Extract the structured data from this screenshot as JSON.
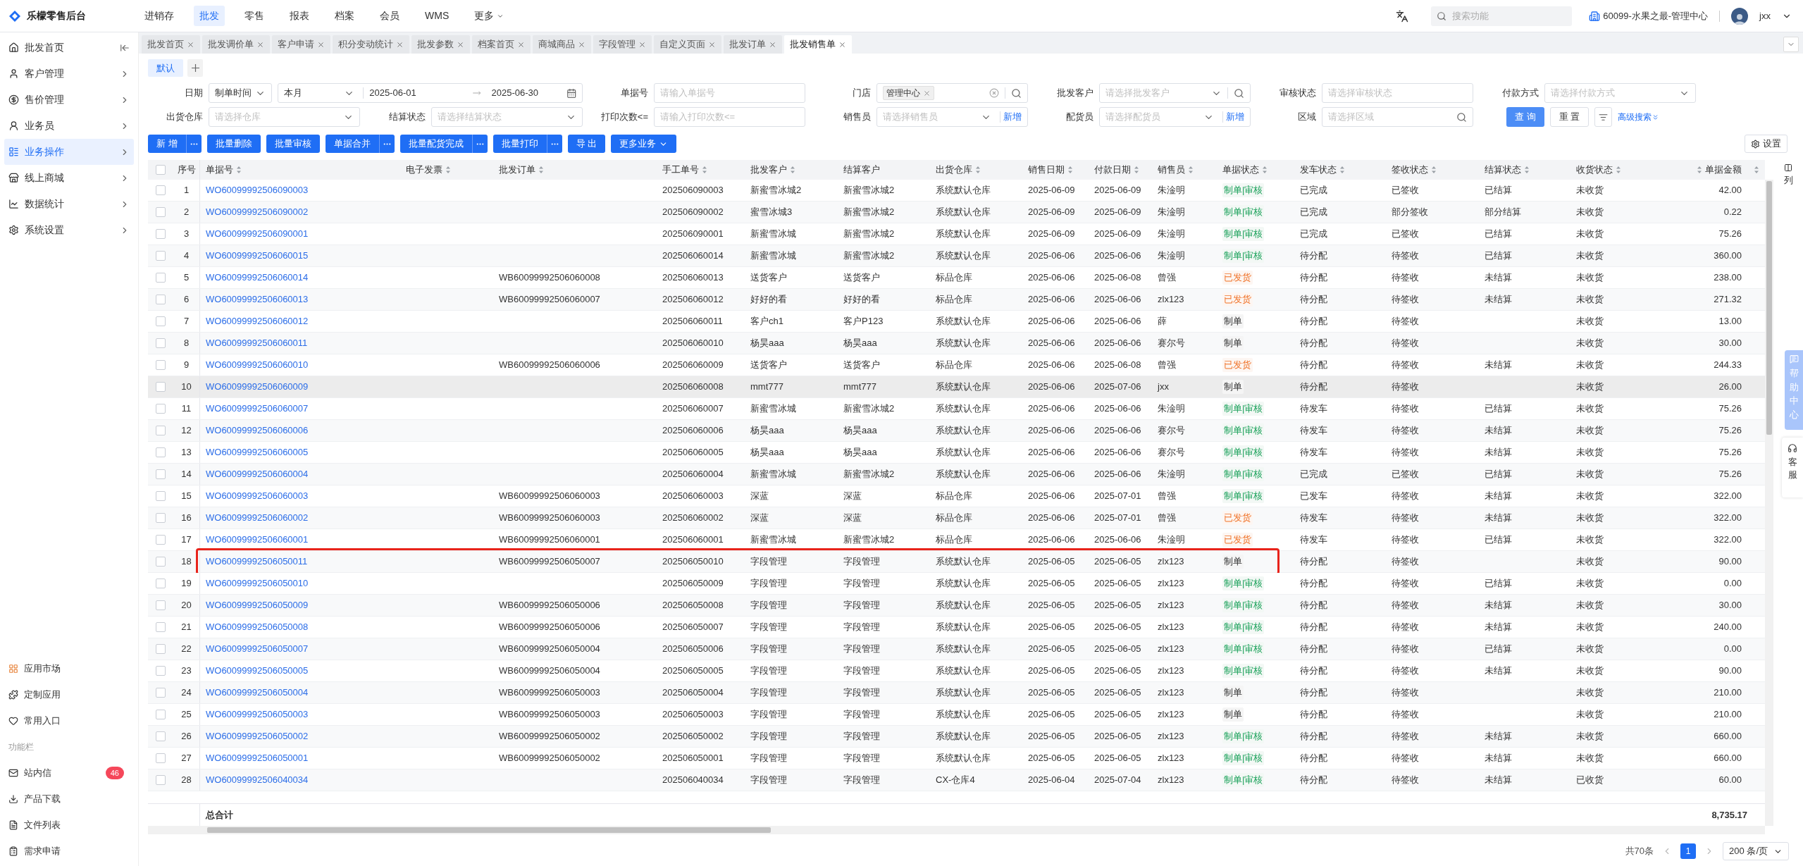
{
  "topbar": {
    "brand": "乐檬零售后台",
    "nav": [
      {
        "label": "进销存",
        "selected": false,
        "dropdown": false
      },
      {
        "label": "批发",
        "selected": true,
        "dropdown": false
      },
      {
        "label": "零售",
        "selected": false,
        "dropdown": false
      },
      {
        "label": "报表",
        "selected": false,
        "dropdown": false
      },
      {
        "label": "档案",
        "selected": false,
        "dropdown": false
      },
      {
        "label": "会员",
        "selected": false,
        "dropdown": false
      },
      {
        "label": "WMS",
        "selected": false,
        "dropdown": false
      },
      {
        "label": "更多",
        "selected": false,
        "dropdown": true
      }
    ],
    "search": {
      "placeholder": "搜索功能"
    },
    "org": "60099-水果之最-管理中心",
    "user": "jxx"
  },
  "sidebar": {
    "items": [
      {
        "label": "批发首页",
        "selected": false,
        "expandable": false
      },
      {
        "label": "客户管理",
        "selected": false,
        "expandable": true
      },
      {
        "label": "售价管理",
        "selected": false,
        "expandable": true
      },
      {
        "label": "业务员",
        "selected": false,
        "expandable": true
      },
      {
        "label": "业务操作",
        "selected": true,
        "expandable": true
      },
      {
        "label": "线上商城",
        "selected": false,
        "expandable": true
      },
      {
        "label": "数据统计",
        "selected": false,
        "expandable": true
      },
      {
        "label": "系统设置",
        "selected": false,
        "expandable": true
      }
    ],
    "bottom_items": [
      {
        "label": "应用市场"
      },
      {
        "label": "定制应用"
      },
      {
        "label": "常用入口"
      }
    ],
    "section_label": "功能栏",
    "tool_items": [
      {
        "label": "站内信",
        "badge": "46"
      },
      {
        "label": "产品下载"
      },
      {
        "label": "文件列表"
      },
      {
        "label": "需求申请"
      }
    ]
  },
  "tabs": [
    {
      "label": "批发首页",
      "selected": false
    },
    {
      "label": "批发调价单",
      "selected": false
    },
    {
      "label": "客户申请",
      "selected": false
    },
    {
      "label": "积分变动统计",
      "selected": false
    },
    {
      "label": "批发参数",
      "selected": false
    },
    {
      "label": "档案首页",
      "selected": false
    },
    {
      "label": "商城商品",
      "selected": false
    },
    {
      "label": "字段管理",
      "selected": false
    },
    {
      "label": "自定义页面",
      "selected": false
    },
    {
      "label": "批发订单",
      "selected": false
    },
    {
      "label": "批发销售单",
      "selected": true
    }
  ],
  "filters": {
    "presets": [
      {
        "label": "默认",
        "selected": true
      }
    ],
    "fields": [
      {
        "label": "日期",
        "kind": "date_range",
        "mode": "制单时间",
        "period": "本月",
        "start": "2025-06-01",
        "end": "2025-06-30"
      },
      {
        "label": "单据号",
        "kind": "text",
        "placeholder": "请输入单据号"
      },
      {
        "label": "门店",
        "kind": "tag_search",
        "tags": [
          "管理中心"
        ]
      },
      {
        "label": "批发客户",
        "kind": "select_search",
        "placeholder": "请选择批发客户"
      },
      {
        "label": "审核状态",
        "kind": "text",
        "placeholder": "请选择审核状态"
      },
      {
        "label": "付款方式",
        "kind": "select",
        "placeholder": "请选择付款方式"
      },
      {
        "label": "出货仓库",
        "kind": "select",
        "placeholder": "请选择仓库"
      },
      {
        "label": "结算状态",
        "kind": "select",
        "placeholder": "请选择结算状态"
      },
      {
        "label": "打印次数<=",
        "kind": "text",
        "placeholder": "请输入打印次数<="
      },
      {
        "label": "销售员",
        "kind": "select_add",
        "placeholder": "请选择销售员",
        "add_label": "新增"
      },
      {
        "label": "配货员",
        "kind": "select_add",
        "placeholder": "请选择配货员",
        "add_label": "新增"
      },
      {
        "label": "区域",
        "kind": "search",
        "placeholder": "请选择区域"
      }
    ],
    "buttons": [
      {
        "label": "查 询",
        "kind": "primary"
      },
      {
        "label": "重 置",
        "kind": "default"
      }
    ],
    "advanced_search": "高级搜索"
  },
  "actions": [
    {
      "label": "新 增",
      "more": true,
      "dropdown": false
    },
    {
      "label": "批量删除",
      "more": false,
      "dropdown": false
    },
    {
      "label": "批量审核",
      "more": false,
      "dropdown": false
    },
    {
      "label": "单据合并",
      "more": true,
      "dropdown": false
    },
    {
      "label": "批量配货完成",
      "more": true,
      "dropdown": false
    },
    {
      "label": "批量打印",
      "more": true,
      "dropdown": false
    },
    {
      "label": "导 出",
      "more": false,
      "dropdown": false
    },
    {
      "label": "更多业务",
      "more": false,
      "dropdown": true
    }
  ],
  "settings_button": "设置",
  "column_settings": "列",
  "help_center": "帮助中心",
  "customer_service": "客服",
  "table": {
    "select_all_checked": false,
    "columns": [
      {
        "label": "序号",
        "sortable": false
      },
      {
        "label": "单据号",
        "sortable": true
      },
      {
        "label": "电子发票",
        "sortable": true
      },
      {
        "label": "批发订单",
        "sortable": true
      },
      {
        "label": "手工单号",
        "sortable": true
      },
      {
        "label": "批发客户",
        "sortable": true
      },
      {
        "label": "结算客户",
        "sortable": false
      },
      {
        "label": "出货仓库",
        "sortable": true
      },
      {
        "label": "销售日期",
        "sortable": true
      },
      {
        "label": "付款日期",
        "sortable": true
      },
      {
        "label": "销售员",
        "sortable": true
      },
      {
        "label": "单据状态",
        "sortable": true
      },
      {
        "label": "发车状态",
        "sortable": true
      },
      {
        "label": "签收状态",
        "sortable": true
      },
      {
        "label": "结算状态",
        "sortable": true
      },
      {
        "label": "收货状态",
        "sortable": true
      },
      {
        "label": "单据金额",
        "sortable": true
      }
    ],
    "rows": [
      {
        "seq": "1",
        "doc_no": "WO60099992506090003",
        "manual_no": "202506090003",
        "wholesale_customer": "新蜜雪冰城2",
        "settle_customer": "新蜜雪冰城2",
        "warehouse": "系统默认仓库",
        "sale_date": "2025-06-09",
        "pay_date": "2025-06-09",
        "salesperson": "朱淦明",
        "doc_status": {
          "text": "制单|审核",
          "kind": "approved"
        },
        "dispatch_status": "已完成",
        "sign_status": "已签收",
        "settle_status": "已结算",
        "receive_status": "未收货",
        "amount": "42.00",
        "checked": false,
        "selected": false,
        "annotated": false
      },
      {
        "seq": "2",
        "doc_no": "WO60099992506090002",
        "manual_no": "202506090002",
        "wholesale_customer": "蜜雪冰城3",
        "settle_customer": "新蜜雪冰城2",
        "warehouse": "系统默认仓库",
        "sale_date": "2025-06-09",
        "pay_date": "2025-06-09",
        "salesperson": "朱淦明",
        "doc_status": {
          "text": "制单|审核",
          "kind": "approved"
        },
        "dispatch_status": "已完成",
        "sign_status": "部分签收",
        "settle_status": "部分结算",
        "receive_status": "未收货",
        "amount": "0.22",
        "checked": false,
        "selected": false,
        "annotated": false
      },
      {
        "seq": "3",
        "doc_no": "WO60099992506090001",
        "manual_no": "202506090001",
        "wholesale_customer": "新蜜雪冰城",
        "settle_customer": "新蜜雪冰城2",
        "warehouse": "系统默认仓库",
        "sale_date": "2025-06-09",
        "pay_date": "2025-06-09",
        "salesperson": "朱淦明",
        "doc_status": {
          "text": "制单|审核",
          "kind": "approved"
        },
        "dispatch_status": "已完成",
        "sign_status": "已签收",
        "settle_status": "已结算",
        "receive_status": "未收货",
        "amount": "75.26",
        "checked": false,
        "selected": false,
        "annotated": false
      },
      {
        "seq": "4",
        "doc_no": "WO60099992506060015",
        "manual_no": "202506060014",
        "wholesale_customer": "新蜜雪冰城",
        "settle_customer": "新蜜雪冰城2",
        "warehouse": "系统默认仓库",
        "sale_date": "2025-06-06",
        "pay_date": "2025-06-06",
        "salesperson": "朱淦明",
        "doc_status": {
          "text": "制单|审核",
          "kind": "approved"
        },
        "dispatch_status": "待分配",
        "sign_status": "待签收",
        "settle_status": "已结算",
        "receive_status": "未收货",
        "amount": "360.00",
        "checked": false,
        "selected": false,
        "annotated": false
      },
      {
        "seq": "5",
        "doc_no": "WO60099992506060014",
        "wholesale_order": "WB60099992506060008",
        "manual_no": "202506060013",
        "wholesale_customer": "送货客户",
        "settle_customer": "送货客户",
        "warehouse": "标品仓库",
        "sale_date": "2025-06-06",
        "pay_date": "2025-06-08",
        "salesperson": "曾强",
        "doc_status": {
          "text": "已发货",
          "kind": "shipped"
        },
        "dispatch_status": "待分配",
        "sign_status": "待签收",
        "settle_status": "未结算",
        "receive_status": "未收货",
        "amount": "238.00",
        "checked": false,
        "selected": false,
        "annotated": false
      },
      {
        "seq": "6",
        "doc_no": "WO60099992506060013",
        "wholesale_order": "WB60099992506060007",
        "manual_no": "202506060012",
        "wholesale_customer": "好好的看",
        "settle_customer": "好好的看",
        "warehouse": "标品仓库",
        "sale_date": "2025-06-06",
        "pay_date": "2025-06-06",
        "salesperson": "zlx123",
        "doc_status": {
          "text": "已发货",
          "kind": "shipped"
        },
        "dispatch_status": "待分配",
        "sign_status": "待签收",
        "settle_status": "未结算",
        "receive_status": "未收货",
        "amount": "271.32",
        "checked": false,
        "selected": false,
        "annotated": false
      },
      {
        "seq": "7",
        "doc_no": "WO60099992506060012",
        "manual_no": "202506060011",
        "wholesale_customer": "客户ch1",
        "settle_customer": "客户P123",
        "warehouse": "系统默认仓库",
        "sale_date": "2025-06-06",
        "pay_date": "2025-06-06",
        "salesperson": "薛",
        "doc_status": {
          "text": "制单",
          "kind": "draft"
        },
        "dispatch_status": "待分配",
        "sign_status": "待签收",
        "receive_status": "未收货",
        "amount": "13.00",
        "checked": false,
        "selected": false,
        "annotated": false
      },
      {
        "seq": "8",
        "doc_no": "WO60099992506060011",
        "manual_no": "202506060010",
        "wholesale_customer": "杨昊aaa",
        "settle_customer": "杨昊aaa",
        "warehouse": "系统默认仓库",
        "sale_date": "2025-06-06",
        "pay_date": "2025-06-06",
        "salesperson": "赛尔号",
        "doc_status": {
          "text": "制单",
          "kind": "draft"
        },
        "dispatch_status": "待分配",
        "sign_status": "待签收",
        "receive_status": "未收货",
        "amount": "30.00",
        "checked": false,
        "selected": false,
        "annotated": false
      },
      {
        "seq": "9",
        "doc_no": "WO60099992506060010",
        "wholesale_order": "WB60099992506060006",
        "manual_no": "202506060009",
        "wholesale_customer": "送货客户",
        "settle_customer": "送货客户",
        "warehouse": "标品仓库",
        "sale_date": "2025-06-06",
        "pay_date": "2025-06-08",
        "salesperson": "曾强",
        "doc_status": {
          "text": "已发货",
          "kind": "shipped"
        },
        "dispatch_status": "待分配",
        "sign_status": "待签收",
        "settle_status": "未结算",
        "receive_status": "未收货",
        "amount": "244.33",
        "checked": false,
        "selected": false,
        "annotated": false
      },
      {
        "seq": "10",
        "doc_no": "WO60099992506060009",
        "manual_no": "202506060008",
        "wholesale_customer": "mmt777",
        "settle_customer": "mmt777",
        "warehouse": "系统默认仓库",
        "sale_date": "2025-06-06",
        "pay_date": "2025-07-06",
        "salesperson": "jxx",
        "doc_status": {
          "text": "制单",
          "kind": "draft"
        },
        "dispatch_status": "待分配",
        "sign_status": "待签收",
        "receive_status": "未收货",
        "amount": "26.00",
        "checked": false,
        "selected": true,
        "annotated": false
      },
      {
        "seq": "11",
        "doc_no": "WO60099992506060007",
        "manual_no": "202506060007",
        "wholesale_customer": "新蜜雪冰城",
        "settle_customer": "新蜜雪冰城2",
        "warehouse": "系统默认仓库",
        "sale_date": "2025-06-06",
        "pay_date": "2025-06-06",
        "salesperson": "朱淦明",
        "doc_status": {
          "text": "制单|审核",
          "kind": "approved"
        },
        "dispatch_status": "待发车",
        "sign_status": "待签收",
        "settle_status": "已结算",
        "receive_status": "未收货",
        "amount": "75.26",
        "checked": false,
        "selected": false,
        "annotated": false
      },
      {
        "seq": "12",
        "doc_no": "WO60099992506060006",
        "manual_no": "202506060006",
        "wholesale_customer": "杨昊aaa",
        "settle_customer": "杨昊aaa",
        "warehouse": "系统默认仓库",
        "sale_date": "2025-06-06",
        "pay_date": "2025-06-06",
        "salesperson": "赛尔号",
        "doc_status": {
          "text": "制单|审核",
          "kind": "approved"
        },
        "dispatch_status": "待发车",
        "sign_status": "待签收",
        "settle_status": "未结算",
        "receive_status": "未收货",
        "amount": "75.26",
        "checked": false,
        "selected": false,
        "annotated": false
      },
      {
        "seq": "13",
        "doc_no": "WO60099992506060005",
        "manual_no": "202506060005",
        "wholesale_customer": "杨昊aaa",
        "settle_customer": "杨昊aaa",
        "warehouse": "系统默认仓库",
        "sale_date": "2025-06-06",
        "pay_date": "2025-06-06",
        "salesperson": "赛尔号",
        "doc_status": {
          "text": "制单|审核",
          "kind": "approved"
        },
        "dispatch_status": "待发车",
        "sign_status": "待签收",
        "settle_status": "未结算",
        "receive_status": "未收货",
        "amount": "75.26",
        "checked": false,
        "selected": false,
        "annotated": false
      },
      {
        "seq": "14",
        "doc_no": "WO60099992506060004",
        "manual_no": "202506060004",
        "wholesale_customer": "新蜜雪冰城",
        "settle_customer": "新蜜雪冰城2",
        "warehouse": "系统默认仓库",
        "sale_date": "2025-06-06",
        "pay_date": "2025-06-06",
        "salesperson": "朱淦明",
        "doc_status": {
          "text": "制单|审核",
          "kind": "approved"
        },
        "dispatch_status": "已完成",
        "sign_status": "已签收",
        "settle_status": "已结算",
        "receive_status": "未收货",
        "amount": "75.26",
        "checked": false,
        "selected": false,
        "annotated": false
      },
      {
        "seq": "15",
        "doc_no": "WO60099992506060003",
        "wholesale_order": "WB60099992506060003",
        "manual_no": "202506060003",
        "wholesale_customer": "深蓝",
        "settle_customer": "深蓝",
        "warehouse": "标品仓库",
        "sale_date": "2025-06-06",
        "pay_date": "2025-07-01",
        "salesperson": "曾强",
        "doc_status": {
          "text": "制单|审核",
          "kind": "approved"
        },
        "dispatch_status": "已发车",
        "sign_status": "待签收",
        "settle_status": "未结算",
        "receive_status": "未收货",
        "amount": "322.00",
        "checked": false,
        "selected": false,
        "annotated": false
      },
      {
        "seq": "16",
        "doc_no": "WO60099992506060002",
        "wholesale_order": "WB60099992506060003",
        "manual_no": "202506060002",
        "wholesale_customer": "深蓝",
        "settle_customer": "深蓝",
        "warehouse": "标品仓库",
        "sale_date": "2025-06-06",
        "pay_date": "2025-07-01",
        "salesperson": "曾强",
        "doc_status": {
          "text": "已发货",
          "kind": "shipped"
        },
        "dispatch_status": "待发车",
        "sign_status": "待签收",
        "settle_status": "未结算",
        "receive_status": "未收货",
        "amount": "322.00",
        "checked": false,
        "selected": false,
        "annotated": false
      },
      {
        "seq": "17",
        "doc_no": "WO60099992506060001",
        "wholesale_order": "WB60099992506060001",
        "manual_no": "202506060001",
        "wholesale_customer": "新蜜雪冰城",
        "settle_customer": "新蜜雪冰城2",
        "warehouse": "标品仓库",
        "sale_date": "2025-06-06",
        "pay_date": "2025-06-06",
        "salesperson": "朱淦明",
        "doc_status": {
          "text": "已发货",
          "kind": "shipped"
        },
        "dispatch_status": "待发车",
        "sign_status": "待签收",
        "settle_status": "已结算",
        "receive_status": "未收货",
        "amount": "322.00",
        "checked": false,
        "selected": false,
        "annotated": false
      },
      {
        "seq": "18",
        "doc_no": "WO60099992506050011",
        "wholesale_order": "WB60099992506050007",
        "manual_no": "202506050010",
        "wholesale_customer": "字段管理",
        "settle_customer": "字段管理",
        "warehouse": "系统默认仓库",
        "sale_date": "2025-06-05",
        "pay_date": "2025-06-05",
        "salesperson": "zlx123",
        "doc_status": {
          "text": "制单",
          "kind": "draft"
        },
        "dispatch_status": "待分配",
        "sign_status": "待签收",
        "receive_status": "未收货",
        "amount": "90.00",
        "checked": false,
        "selected": false,
        "annotated": true
      },
      {
        "seq": "19",
        "doc_no": "WO60099992506050010",
        "manual_no": "202506050009",
        "wholesale_customer": "字段管理",
        "settle_customer": "字段管理",
        "warehouse": "系统默认仓库",
        "sale_date": "2025-06-05",
        "pay_date": "2025-06-05",
        "salesperson": "zlx123",
        "doc_status": {
          "text": "制单|审核",
          "kind": "approved"
        },
        "dispatch_status": "待分配",
        "sign_status": "待签收",
        "settle_status": "已结算",
        "receive_status": "未收货",
        "amount": "0.00",
        "checked": false,
        "selected": false,
        "annotated": false
      },
      {
        "seq": "20",
        "doc_no": "WO60099992506050009",
        "wholesale_order": "WB60099992506050006",
        "manual_no": "202506050008",
        "wholesale_customer": "字段管理",
        "settle_customer": "字段管理",
        "warehouse": "系统默认仓库",
        "sale_date": "2025-06-05",
        "pay_date": "2025-06-05",
        "salesperson": "zlx123",
        "doc_status": {
          "text": "制单|审核",
          "kind": "approved"
        },
        "dispatch_status": "待分配",
        "sign_status": "待签收",
        "settle_status": "未结算",
        "receive_status": "未收货",
        "amount": "30.00",
        "checked": false,
        "selected": false,
        "annotated": false
      },
      {
        "seq": "21",
        "doc_no": "WO60099992506050008",
        "wholesale_order": "WB60099992506050006",
        "manual_no": "202506050007",
        "wholesale_customer": "字段管理",
        "settle_customer": "字段管理",
        "warehouse": "系统默认仓库",
        "sale_date": "2025-06-05",
        "pay_date": "2025-06-05",
        "salesperson": "zlx123",
        "doc_status": {
          "text": "制单|审核",
          "kind": "approved"
        },
        "dispatch_status": "待分配",
        "sign_status": "待签收",
        "settle_status": "未结算",
        "receive_status": "未收货",
        "amount": "240.00",
        "checked": false,
        "selected": false,
        "annotated": false
      },
      {
        "seq": "22",
        "doc_no": "WO60099992506050007",
        "wholesale_order": "WB60099992506050004",
        "manual_no": "202506050006",
        "wholesale_customer": "字段管理",
        "settle_customer": "字段管理",
        "warehouse": "系统默认仓库",
        "sale_date": "2025-06-05",
        "pay_date": "2025-06-05",
        "salesperson": "zlx123",
        "doc_status": {
          "text": "制单|审核",
          "kind": "approved"
        },
        "dispatch_status": "待分配",
        "sign_status": "待签收",
        "settle_status": "已结算",
        "receive_status": "未收货",
        "amount": "0.00",
        "checked": false,
        "selected": false,
        "annotated": false
      },
      {
        "seq": "23",
        "doc_no": "WO60099992506050005",
        "wholesale_order": "WB60099992506050004",
        "manual_no": "202506050005",
        "wholesale_customer": "字段管理",
        "settle_customer": "字段管理",
        "warehouse": "系统默认仓库",
        "sale_date": "2025-06-05",
        "pay_date": "2025-06-05",
        "salesperson": "zlx123",
        "doc_status": {
          "text": "制单|审核",
          "kind": "approved"
        },
        "dispatch_status": "待分配",
        "sign_status": "待签收",
        "settle_status": "未结算",
        "receive_status": "未收货",
        "amount": "90.00",
        "checked": false,
        "selected": false,
        "annotated": false
      },
      {
        "seq": "24",
        "doc_no": "WO60099992506050004",
        "wholesale_order": "WB60099992506050003",
        "manual_no": "202506050004",
        "wholesale_customer": "字段管理",
        "settle_customer": "字段管理",
        "warehouse": "系统默认仓库",
        "sale_date": "2025-06-05",
        "pay_date": "2025-06-05",
        "salesperson": "zlx123",
        "doc_status": {
          "text": "制单",
          "kind": "draft"
        },
        "dispatch_status": "待分配",
        "sign_status": "待签收",
        "receive_status": "未收货",
        "amount": "210.00",
        "checked": false,
        "selected": false,
        "annotated": false
      },
      {
        "seq": "25",
        "doc_no": "WO60099992506050003",
        "wholesale_order": "WB60099992506050003",
        "manual_no": "202506050003",
        "wholesale_customer": "字段管理",
        "settle_customer": "字段管理",
        "warehouse": "系统默认仓库",
        "sale_date": "2025-06-05",
        "pay_date": "2025-06-05",
        "salesperson": "zlx123",
        "doc_status": {
          "text": "制单",
          "kind": "draft"
        },
        "dispatch_status": "待分配",
        "sign_status": "待签收",
        "receive_status": "未收货",
        "amount": "210.00",
        "checked": false,
        "selected": false,
        "annotated": false
      },
      {
        "seq": "26",
        "doc_no": "WO60099992506050002",
        "wholesale_order": "WB60099992506050002",
        "manual_no": "202506050002",
        "wholesale_customer": "字段管理",
        "settle_customer": "字段管理",
        "warehouse": "系统默认仓库",
        "sale_date": "2025-06-05",
        "pay_date": "2025-06-05",
        "salesperson": "zlx123",
        "doc_status": {
          "text": "制单|审核",
          "kind": "approved"
        },
        "dispatch_status": "待分配",
        "sign_status": "待签收",
        "settle_status": "未结算",
        "receive_status": "未收货",
        "amount": "660.00",
        "checked": false,
        "selected": false,
        "annotated": false
      },
      {
        "seq": "27",
        "doc_no": "WO60099992506050001",
        "wholesale_order": "WB60099992506050002",
        "manual_no": "202506050001",
        "wholesale_customer": "字段管理",
        "settle_customer": "字段管理",
        "warehouse": "系统默认仓库",
        "sale_date": "2025-06-05",
        "pay_date": "2025-06-05",
        "salesperson": "zlx123",
        "doc_status": {
          "text": "制单|审核",
          "kind": "approved"
        },
        "dispatch_status": "待分配",
        "sign_status": "待签收",
        "settle_status": "未结算",
        "receive_status": "未收货",
        "amount": "660.00",
        "checked": false,
        "selected": false,
        "annotated": false
      },
      {
        "seq": "28",
        "doc_no": "WO60099992506040034",
        "manual_no": "202506040034",
        "wholesale_customer": "字段管理",
        "settle_customer": "字段管理",
        "warehouse": "CX-仓库4",
        "sale_date": "2025-06-04",
        "pay_date": "2025-07-04",
        "salesperson": "zlx123",
        "doc_status": {
          "text": "制单|审核",
          "kind": "approved"
        },
        "dispatch_status": "待分配",
        "sign_status": "待签收",
        "settle_status": "未结算",
        "receive_status": "已收货",
        "amount": "60.00",
        "checked": false,
        "selected": false,
        "annotated": false
      }
    ],
    "total": {
      "label": "总合计",
      "amount": "8,735.17"
    }
  },
  "pagination": {
    "total": "共70条",
    "pages": [
      {
        "label": "1",
        "selected": true
      }
    ],
    "page_size": "200 条/页"
  }
}
